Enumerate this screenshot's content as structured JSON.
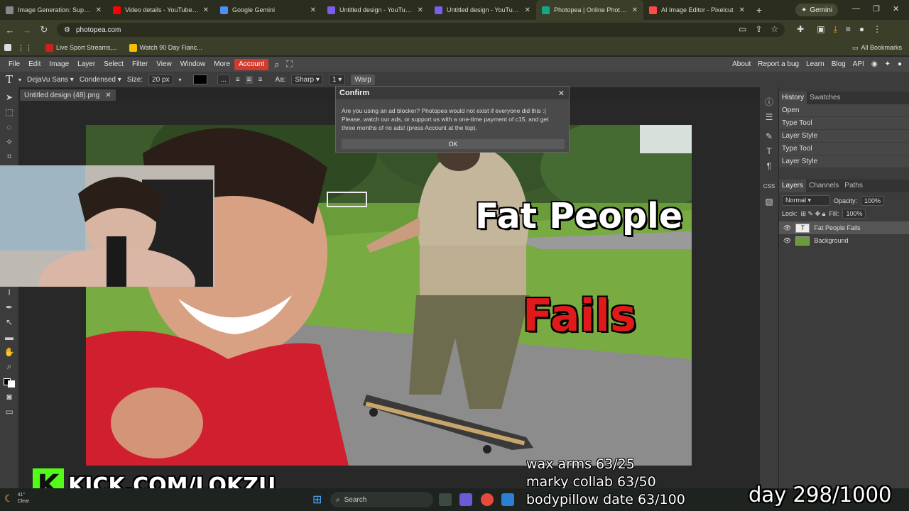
{
  "browser": {
    "tabs": [
      {
        "title": "Image Generation: Super Fat",
        "color": "#888888"
      },
      {
        "title": "Video details - YouTube Studi",
        "color": "#ff0000"
      },
      {
        "title": "Google Gemini",
        "color": "#4c8df6"
      },
      {
        "title": "Untitled design - YouTube Th",
        "color": "#7d5cf0"
      },
      {
        "title": "Untitled design - YouTube Th",
        "color": "#7d5cf0"
      },
      {
        "title": "Photopea | Online Photo Edit",
        "color": "#17a589"
      },
      {
        "title": "AI Image Editor - Pixelcut",
        "color": "#ff4a4a"
      }
    ],
    "active_tab_index": 5,
    "new_tab": "+",
    "gemini_button": "Gemini",
    "url": "photopea.com",
    "bookmarks": [
      {
        "label": "Live Sport Streams,...",
        "color": "#d02020"
      },
      {
        "label": "Watch 90 Day Fianc...",
        "color": "#f2c200"
      }
    ],
    "all_bookmarks": "All Bookmarks"
  },
  "photopea": {
    "menu": [
      "File",
      "Edit",
      "Image",
      "Layer",
      "Select",
      "Filter",
      "View",
      "Window",
      "More"
    ],
    "account": "Account",
    "right_links": [
      "About",
      "Report a bug",
      "Learn",
      "Blog",
      "API"
    ],
    "options": {
      "font": "DejaVu Sans",
      "style": "Condensed",
      "size_label": "Size:",
      "size": "20 px",
      "aa_label": "Aa:",
      "aa": "Sharp",
      "spacing": "1",
      "warp": "Warp",
      "ellipsis": "..."
    },
    "doc_tab": "Untitled design (48).png",
    "canvas": {
      "title_line1": "Fat People",
      "title_line2": "Fails"
    },
    "confirm": {
      "title": "Confirm",
      "message": "Are you using an ad blocker? Photopea would not exist if everyone did this :( Please, watch our ads, or support us with a one-time payment of c15, and get three months of no ads! (press Account at the top).",
      "ok": "OK"
    },
    "history": {
      "tabs": [
        "History",
        "Swatches"
      ],
      "items": [
        "Open",
        "Type Tool",
        "Layer Style",
        "Type Tool",
        "Layer Style"
      ]
    },
    "layers": {
      "tabs": [
        "Layers",
        "Channels",
        "Paths"
      ],
      "blend": "Normal",
      "opacity_label": "Opacity:",
      "opacity": "100%",
      "lock_label": "Lock:",
      "fill_label": "Fill:",
      "fill": "100%",
      "items": [
        "Fat People Fails",
        "Background"
      ]
    }
  },
  "overlay": {
    "kick": "KICK.COM/LOKZU",
    "kick_logo": "K",
    "lines": [
      "wax arms 63/25",
      "marky collab 63/50",
      "bodypillow date 63/100"
    ],
    "day": "day 298/1000"
  },
  "taskbar": {
    "search": "Search",
    "weather_temp": "41°",
    "weather_cond": "Clear"
  }
}
